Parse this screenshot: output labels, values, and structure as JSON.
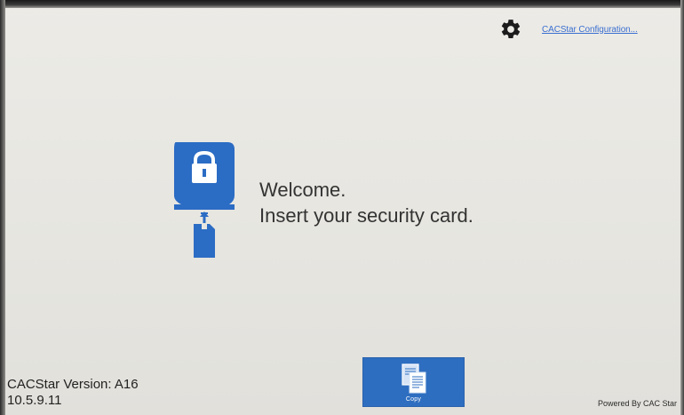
{
  "header": {
    "config_link_label": "CACStar Configuration...",
    "gear_icon": "gear-icon"
  },
  "main": {
    "card_icon": "security-card-lock-icon",
    "welcome_line1": "Welcome.",
    "welcome_line2": "Insert your security card."
  },
  "footer": {
    "version_label": "CACStar Version: A16",
    "ip_address": "10.5.9.11",
    "copy_label": "Copy",
    "copy_icon": "copy-documents-icon",
    "powered_by": "Powered By CAC Star"
  },
  "colors": {
    "accent_blue": "#2e6ec0",
    "link_blue": "#3b6fd1",
    "background": "#e8e7e2"
  }
}
